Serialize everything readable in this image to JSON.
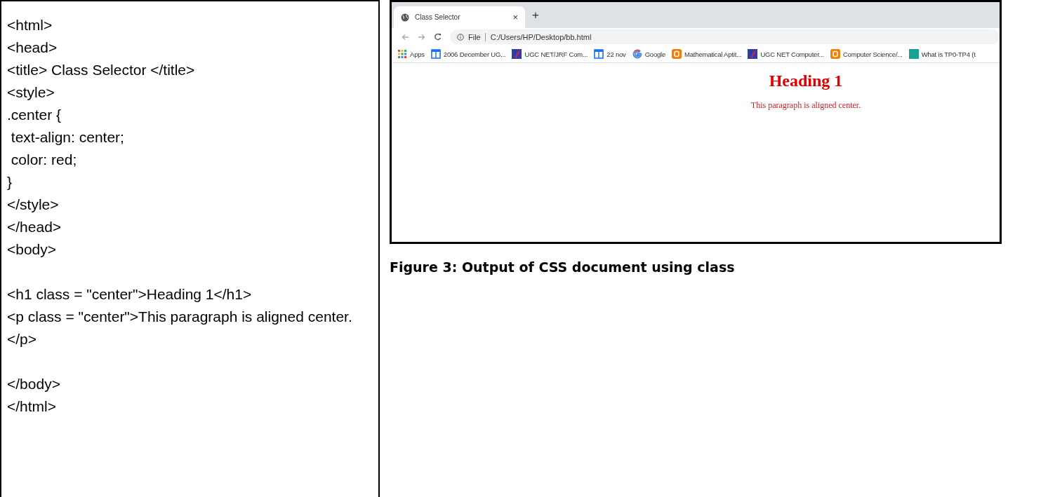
{
  "code_blocks": [
    [
      "<html>",
      "<head>",
      "<title> Class Selector </title>",
      "<style>",
      ".center {",
      " text-align: center;",
      " color: red;",
      "}",
      "</style>",
      "</head>",
      "<body>"
    ],
    [
      "<h1 class = \"center\">Heading 1</h1>",
      "<p class = \"center\">This paragraph is aligned center.</p>"
    ],
    [
      "</body>",
      "</html>"
    ]
  ],
  "browser": {
    "tab": {
      "title": "Class Selector",
      "close": "×"
    },
    "new_tab": "+",
    "address": {
      "scheme": "File",
      "url": "C:/Users/HP/Desktop/bb.html"
    },
    "bookmarks": [
      {
        "kind": "apps",
        "label": "Apps"
      },
      {
        "kind": "calendar",
        "label": "2006 December UG..."
      },
      {
        "kind": "flag",
        "label": "UGC NET/JRF Com..."
      },
      {
        "kind": "calendar",
        "label": "22 nov"
      },
      {
        "kind": "google",
        "label": "Google"
      },
      {
        "kind": "blogger",
        "label": "Mathematical Aptit..."
      },
      {
        "kind": "flag",
        "label": "UGC NET Computer..."
      },
      {
        "kind": "blogger",
        "label": "Computer Science/..."
      },
      {
        "kind": "square",
        "label": "What is TP0-TP4 (t"
      }
    ],
    "page": {
      "heading": "Heading 1",
      "paragraph": "This paragraph is aligned center."
    }
  },
  "caption": "Figure 3: Output of CSS document using class"
}
